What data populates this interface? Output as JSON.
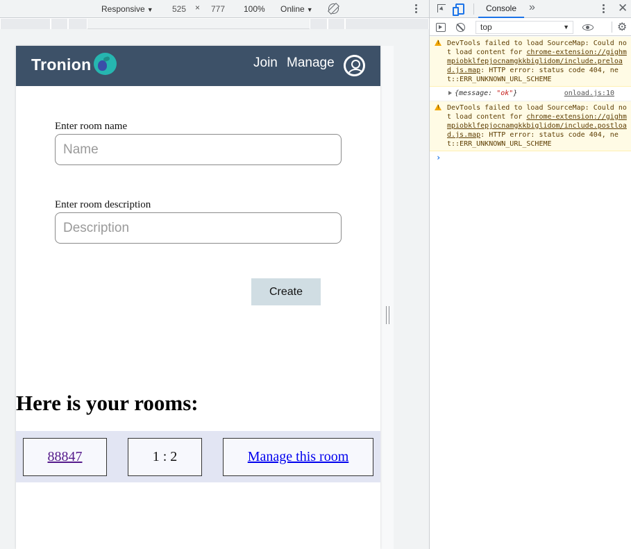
{
  "device_toolbar": {
    "preset": "Responsive",
    "width": "525",
    "times": "×",
    "height": "777",
    "zoom": "100%",
    "network": "Online",
    "caret": "▼"
  },
  "app": {
    "brand": "Tronion",
    "nav": {
      "join": "Join",
      "manage": "Manage"
    },
    "form": {
      "name_label": "Enter room name",
      "name_placeholder": "Name",
      "name_value": "",
      "desc_label": "Enter room description",
      "desc_placeholder": "Description",
      "desc_value": "",
      "create_label": "Create"
    },
    "rooms": {
      "heading": "Here is your rooms:",
      "items": [
        {
          "id": "88847",
          "ratio": "1 : 2",
          "manage_label": "Manage this room"
        }
      ]
    }
  },
  "devtools": {
    "active_tab": "Console",
    "more": "»",
    "close": "✕",
    "context": "top",
    "caret": "▼",
    "settings": "⚙",
    "prompt": "›",
    "messages": [
      {
        "pre": "DevTools failed to load SourceMap: Could not load content for ",
        "link": "chrome-extension://gighmmpiobklfepjocnamgkkbiglidom/include.preload.js.map",
        "post": ": HTTP error: status code 404, net::ERR_UNKNOWN_URL_SCHEME"
      },
      {
        "pre": "DevTools failed to load SourceMap: Could not load content for ",
        "link": "chrome-extension://gighmmpiobklfepjocnamgkkbiglidom/include.postload.js.map",
        "post": ": HTTP error: status code 404, net::ERR_UNKNOWN_URL_SCHEME"
      }
    ],
    "log": {
      "open": "{",
      "key": "message: ",
      "value": "\"ok\"",
      "close": "}",
      "source": "onload.js:10"
    }
  },
  "colors": {
    "navbar": "#3d5168",
    "rooms_row": "#e2e5f3",
    "create_button": "#d0dde3",
    "logo": "#26b6b0",
    "devtools_accent": "#1a73e8",
    "warning_bg": "#fffbe5"
  }
}
